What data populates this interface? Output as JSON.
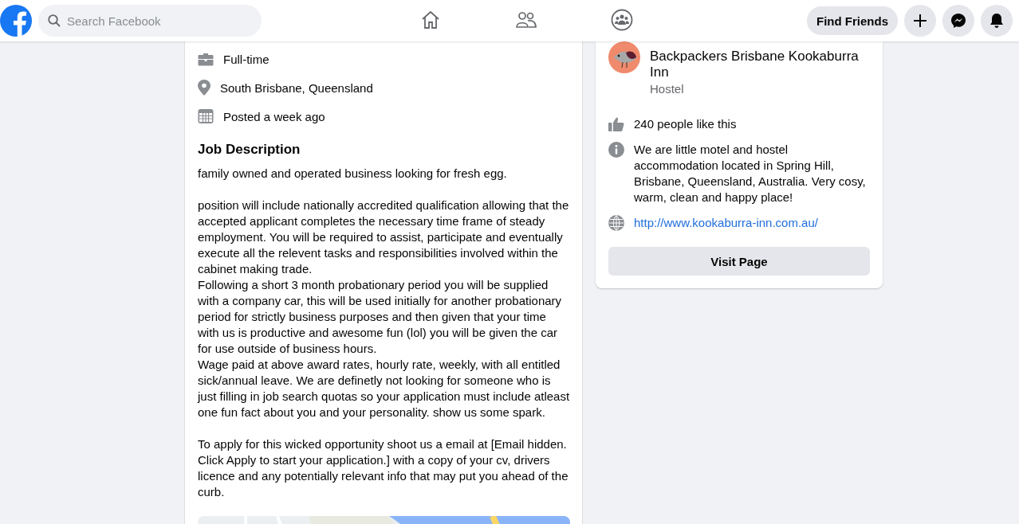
{
  "header": {
    "search": {
      "placeholder": "Search Facebook"
    },
    "nav": [
      {
        "selected": false
      },
      {
        "selected": false
      },
      {
        "selected": false
      }
    ],
    "find_friends": "Find Friends"
  },
  "job": {
    "facts": [
      {
        "text": "Full-time"
      },
      {
        "text": "South Brisbane, Queensland"
      },
      {
        "text": "Posted a week ago"
      }
    ],
    "description_title": "Job Description",
    "description": [
      [
        "family owned and operated business looking for fresh egg."
      ],
      [
        "position will include nationally accredited qualification allowing that the accepted applicant completes the necessary time frame of steady employment. You will be required to assist, participate and eventually execute all the relevent tasks and responsibilities involved within the cabinet making trade.",
        "Following a short 3 month probationary period you will be supplied with a company car, this will be used initially for another probationary period for strictly business purposes and then given that your time with us is productive and awesome fun (lol) you will be given the car for use outside of business hours.",
        "Wage paid at above award rates, hourly rate, weekly, with all entitled sick/annual leave. We are definetly not looking for someone who is just filling in job search quotas so your application must include atleast one fun fact about you and your personality. show us some spark."
      ],
      [
        "To apply for this wicked opportunity shoot us a email at [Email hidden. Click Apply to start your application.] with a copy of your cv, drivers licence and any potentially relevant info that may put you ahead of the curb."
      ]
    ]
  },
  "page": {
    "name": "Backpackers Brisbane Kookaburra Inn",
    "category": "Hostel",
    "details": [
      {
        "kind": "text",
        "text": "240 people like this"
      },
      {
        "kind": "text",
        "text": "We are little motel and hostel accommodation located in Spring Hill, Brisbane, Queensland, Australia. Very cosy, warm, clean and happy place!"
      },
      {
        "kind": "link",
        "text": "http://www.kookaburra-inn.com.au/"
      }
    ],
    "button": "Visit Page"
  }
}
